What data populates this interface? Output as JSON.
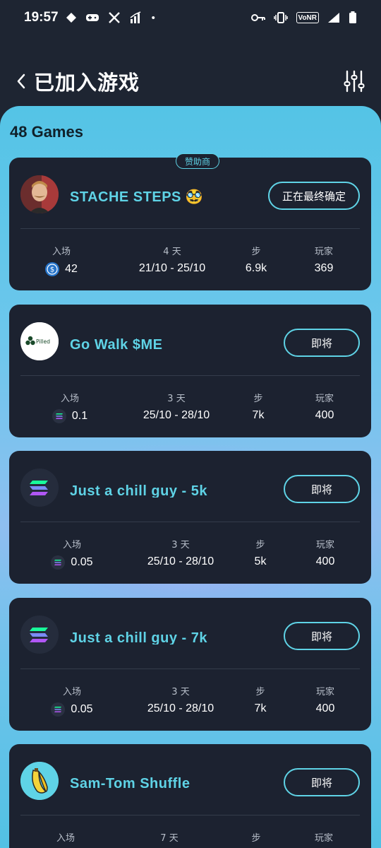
{
  "statusbar": {
    "time": "19:57",
    "dot": "•",
    "network": "VoNR"
  },
  "header": {
    "title": "已加入游戏"
  },
  "games_count": "48 Games",
  "stat_labels": {
    "entry": "入场",
    "steps": "步",
    "players": "玩家"
  },
  "cards": [
    {
      "title": "STACHE STEPS 🥸",
      "badge": "赞助商",
      "status": "正在最终确定",
      "days": "4 天",
      "entry": "42",
      "entry_icon": "usdc-coin-icon",
      "dates": "21/10 - 25/10",
      "steps": "6.9k",
      "players": "369"
    },
    {
      "title": "Go Walk $ME",
      "avatar_text": "Pilled",
      "status": "即将",
      "days": "3 天",
      "entry": "0.1",
      "entry_icon": "solana-coin-icon",
      "dates": "25/10 - 28/10",
      "steps": "7k",
      "players": "400"
    },
    {
      "title": "Just a chill guy - 5k",
      "status": "即将",
      "days": "3 天",
      "entry": "0.05",
      "entry_icon": "solana-coin-icon",
      "dates": "25/10 - 28/10",
      "steps": "5k",
      "players": "400"
    },
    {
      "title": "Just a chill guy - 7k",
      "status": "即将",
      "days": "3 天",
      "entry": "0.05",
      "entry_icon": "solana-coin-icon",
      "dates": "25/10 - 28/10",
      "steps": "7k",
      "players": "400"
    },
    {
      "title": "Sam-Tom Shuffle",
      "status": "即将",
      "days": "7 天",
      "entry": "",
      "entry_icon": "solana-coin-icon",
      "dates": "",
      "steps": "",
      "players": ""
    }
  ],
  "colors": {
    "accent": "#5fd3e6",
    "card_bg": "#1c2230",
    "page_bg": "#1e2532"
  }
}
